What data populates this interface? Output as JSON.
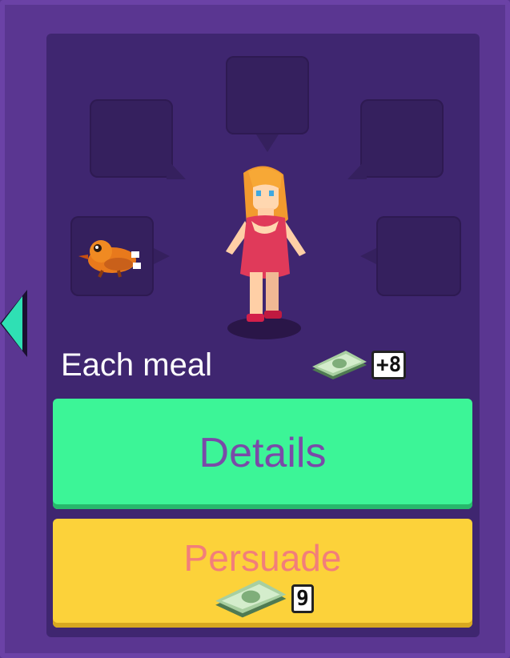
{
  "card": {
    "caption": "Each meal",
    "reward_amount": "+8",
    "reward_icon": "money-icon"
  },
  "buttons": {
    "details_label": "Details",
    "persuade_label": "Persuade",
    "persuade_cost": "9",
    "cost_icon": "money-icon"
  },
  "thought_slots": {
    "filled_item": "roast-chicken-icon"
  },
  "colors": {
    "background": "#5a3691",
    "card": "#3f2670",
    "details_button": "#3cf597",
    "details_text": "#7a4aa8",
    "persuade_button": "#fcd23a",
    "persuade_text": "#f27e7a",
    "nav_arrow": "#2fe0b4"
  }
}
